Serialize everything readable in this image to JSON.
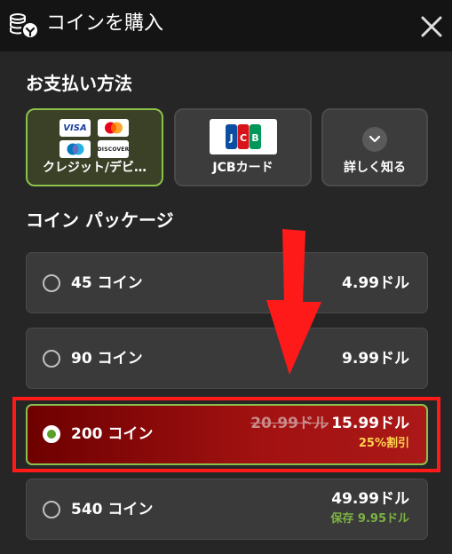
{
  "header": {
    "title": "コインを購入",
    "icon": "coins-icon",
    "close_icon": "close-icon"
  },
  "payment": {
    "title": "お支払い方法",
    "methods": [
      {
        "label": "クレジット/デビ…",
        "selected": true,
        "logos": [
          "VISA",
          "mastercard",
          "amex",
          "DISCOVER"
        ]
      },
      {
        "label": "JCBカード",
        "selected": false,
        "logo_text": "JCB"
      },
      {
        "label": "詳しく知る",
        "selected": false,
        "icon": "chevron-down-icon"
      }
    ]
  },
  "packages": {
    "title": "コイン パッケージ",
    "items": [
      {
        "name": "45 コイン",
        "price": "4.99ドル",
        "selected": false
      },
      {
        "name": "90 コイン",
        "price": "9.99ドル",
        "selected": false
      },
      {
        "name": "200 コイン",
        "old_price": "20.99ドル",
        "price": "15.99ドル",
        "note": "25%割引",
        "selected": true
      },
      {
        "name": "540 コイン",
        "price": "49.99ドル",
        "note": "保存 9.95ドル",
        "selected": false
      }
    ]
  },
  "colors": {
    "background": "#262626",
    "header": "#141414",
    "selected_border": "#8bc34a",
    "highlight_red": "#ff1a1a",
    "discount_yellow": "#ffd54f",
    "save_green": "#7cb342"
  }
}
